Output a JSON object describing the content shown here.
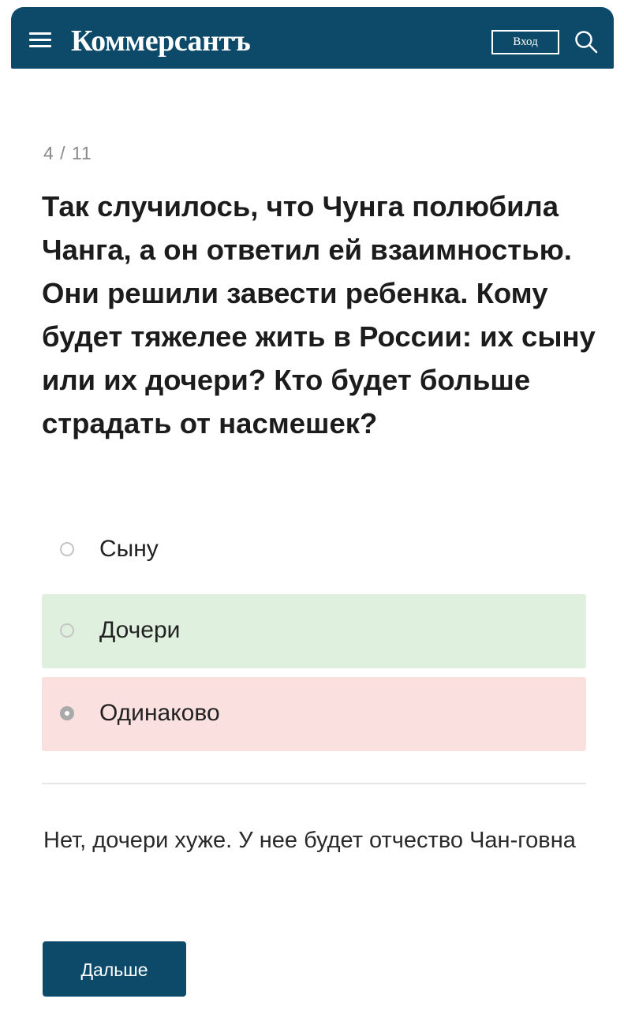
{
  "header": {
    "logo_text": "Коммерсантъ",
    "login_label": "Вход",
    "menu_icon": "hamburger-menu-icon",
    "search_icon": "search-icon",
    "background_color": "#0d4a6a"
  },
  "quiz": {
    "counter": "4 / 11",
    "question": "Так случилось, что Чунга полюбила Чанга, а он ответил ей взаимностью. Они решили завести ребенка. Кому будет тяжелее жить в России: их сыну или их дочери? Кто будет больше страдать от насмешек?",
    "options": [
      {
        "label": "Сыну",
        "state": "neutral",
        "selected": false
      },
      {
        "label": "Дочери",
        "state": "correct",
        "selected": false,
        "color": "#dff0df"
      },
      {
        "label": "Одинаково",
        "state": "incorrect",
        "selected": true,
        "color": "#fbe0e0"
      }
    ],
    "explanation": "Нет, дочери хуже. У нее будет отчество Чан-говна",
    "next_label": "Дальше"
  }
}
